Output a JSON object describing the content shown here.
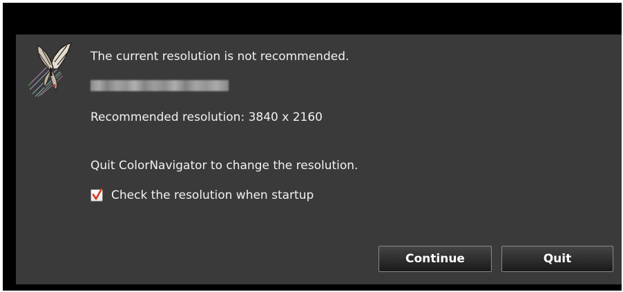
{
  "dialog": {
    "icon": "butterfly-icon",
    "title_message": "The current resolution is not recommended.",
    "recommended_text": "Recommended resolution: 3840 x 2160",
    "quit_instruction": "Quit ColorNavigator to change the resolution.",
    "checkbox": {
      "label": "Check the resolution when startup",
      "checked": true,
      "check_color": "#d9341e"
    },
    "buttons": {
      "continue_label": "Continue",
      "quit_label": "Quit"
    },
    "colors": {
      "panel_bg": "#3a3a3a",
      "frame_bg": "#000000",
      "text": "#f2f2f2"
    }
  }
}
